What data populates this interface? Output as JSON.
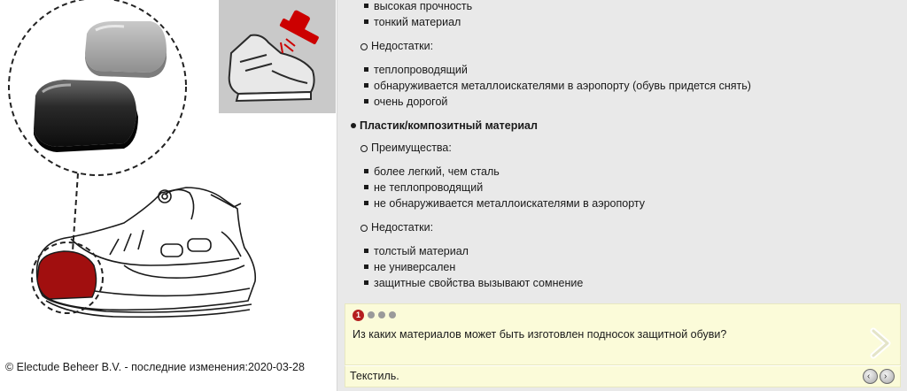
{
  "left": {
    "copyright": "© Electude Beheer B.V. - последние изменения:2020-03-28"
  },
  "content": {
    "steel_pros": [
      "высокая прочность",
      "тонкий материал"
    ],
    "steel_cons_label": "Недостатки:",
    "steel_cons": [
      "теплопроводящий",
      "обнаруживается металлоискателями в аэропорту (обувь придется снять)",
      "очень дорогой"
    ],
    "composite_heading": "Пластик/композитный материал",
    "composite_pros_label": "Преимущества:",
    "composite_pros": [
      "более легкий, чем сталь",
      "не теплопроводящий",
      "не обнаруживается металлоискателями в аэропорту"
    ],
    "composite_cons_label": "Недостатки:",
    "composite_cons": [
      "толстый материал",
      "не универсален",
      "защитные свойства вызывают сомнение"
    ]
  },
  "quiz": {
    "active_page": "1",
    "question": "Из каких материалов может быть изготовлен подносок защитной обуви?",
    "answer": "Текстиль."
  },
  "icons": {
    "next": "chevron-right-icon",
    "prev_round": "round-prev-icon",
    "next_round": "round-next-icon"
  },
  "colors": {
    "accent_red": "#b51f1f",
    "quiz_bg": "#fbfbd9",
    "panel_bg": "#e9e9e9"
  }
}
